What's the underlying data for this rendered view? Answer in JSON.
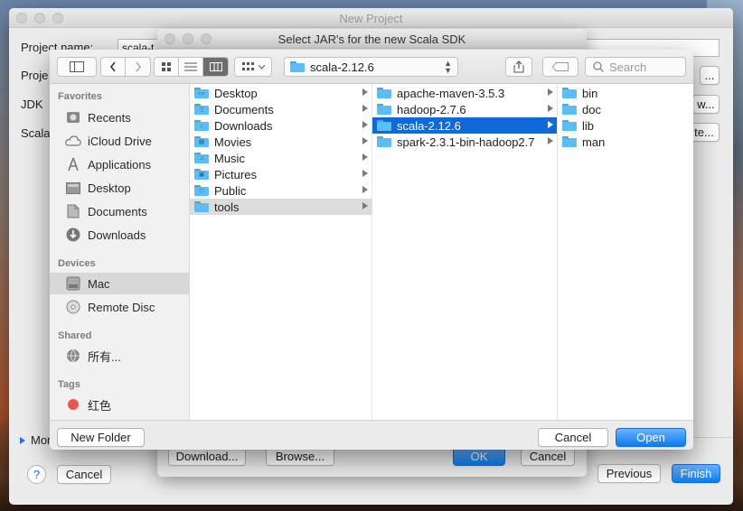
{
  "main_window": {
    "title": "New Project",
    "project_name_label": "Project name:",
    "project_name_value": "scala-t",
    "project_location_label": "Proje",
    "jdk_label": "JDK",
    "scala_label": "Scala",
    "dots_button": "...",
    "new_button_partial": "w...",
    "create_button_partial": "te...",
    "more_settings_label": "Mor",
    "help_label": "?",
    "cancel_label": "Cancel",
    "previous_label": "Previous",
    "finish_label": "Finish"
  },
  "mid_dialog": {
    "title": "Select JAR's for the new Scala SDK",
    "download_label": "Download...",
    "browse_label": "Browse...",
    "ok_label": "OK",
    "cancel_label": "Cancel"
  },
  "sheet": {
    "path_label": "scala-2.12.6",
    "search_placeholder": "Search",
    "sidebar": {
      "favorites_header": "Favorites",
      "favorites": [
        {
          "label": "Recents",
          "icon": "recents-icon"
        },
        {
          "label": "iCloud Drive",
          "icon": "cloud-icon"
        },
        {
          "label": "Applications",
          "icon": "applications-icon"
        },
        {
          "label": "Desktop",
          "icon": "desktop-icon"
        },
        {
          "label": "Documents",
          "icon": "documents-icon"
        },
        {
          "label": "Downloads",
          "icon": "downloads-icon"
        }
      ],
      "devices_header": "Devices",
      "devices": [
        {
          "label": "Mac",
          "icon": "hard-drive-icon",
          "selected": true
        },
        {
          "label": "Remote Disc",
          "icon": "disc-icon"
        }
      ],
      "shared_header": "Shared",
      "shared": [
        {
          "label": "所有...",
          "icon": "network-icon"
        }
      ],
      "tags_header": "Tags",
      "tags": [
        {
          "label": "红色",
          "icon": "red-tag-icon",
          "color": "#f0524f"
        }
      ]
    },
    "column1": [
      "Desktop",
      "Documents",
      "Downloads",
      "Movies",
      "Music",
      "Pictures",
      "Public",
      "tools"
    ],
    "column2": [
      "apache-maven-3.5.3",
      "hadoop-2.7.6",
      "scala-2.12.6",
      "spark-2.3.1-bin-hadoop2.7"
    ],
    "column3": [
      "bin",
      "doc",
      "lib",
      "man"
    ],
    "new_folder_label": "New Folder",
    "cancel_label": "Cancel",
    "open_label": "Open"
  },
  "colors": {
    "accent": "#0f69d8",
    "folder": "#5bbdf1"
  }
}
